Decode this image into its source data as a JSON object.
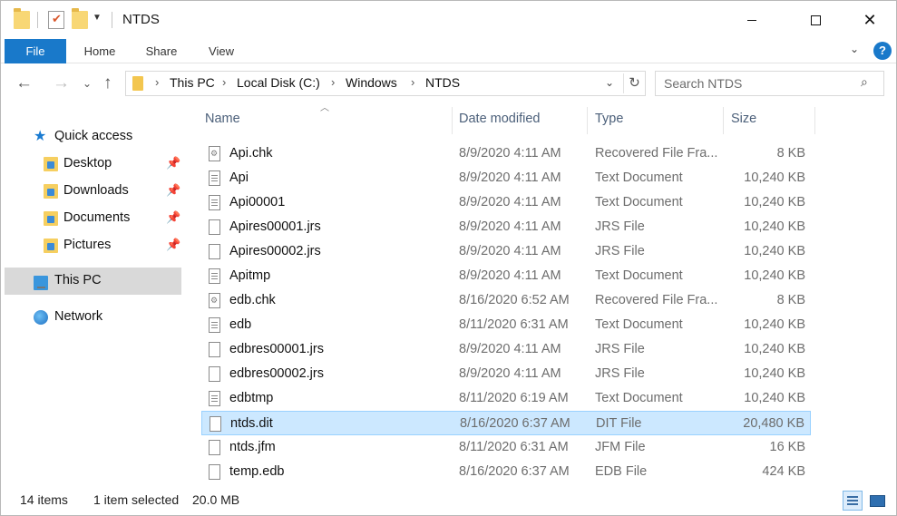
{
  "window": {
    "title": "NTDS"
  },
  "ribbon": {
    "tabs": [
      "File",
      "Home",
      "Share",
      "View"
    ],
    "help_label": "?"
  },
  "address": {
    "crumbs": [
      "This PC",
      "Local Disk (C:)",
      "Windows",
      "NTDS"
    ]
  },
  "search": {
    "placeholder": "Search NTDS"
  },
  "nav": {
    "quick_access": "Quick access",
    "pinned": [
      {
        "label": "Desktop"
      },
      {
        "label": "Downloads"
      },
      {
        "label": "Documents"
      },
      {
        "label": "Pictures"
      }
    ],
    "this_pc": "This PC",
    "network": "Network"
  },
  "columns": {
    "name": "Name",
    "date": "Date modified",
    "type": "Type",
    "size": "Size"
  },
  "files": [
    {
      "name": "Api.chk",
      "date": "8/9/2020 4:11 AM",
      "type": "Recovered File Fra...",
      "size": "8 KB",
      "icon": "chk",
      "selected": false
    },
    {
      "name": "Api",
      "date": "8/9/2020 4:11 AM",
      "type": "Text Document",
      "size": "10,240 KB",
      "icon": "txt",
      "selected": false
    },
    {
      "name": "Api00001",
      "date": "8/9/2020 4:11 AM",
      "type": "Text Document",
      "size": "10,240 KB",
      "icon": "txt",
      "selected": false
    },
    {
      "name": "Apires00001.jrs",
      "date": "8/9/2020 4:11 AM",
      "type": "JRS File",
      "size": "10,240 KB",
      "icon": "blank",
      "selected": false
    },
    {
      "name": "Apires00002.jrs",
      "date": "8/9/2020 4:11 AM",
      "type": "JRS File",
      "size": "10,240 KB",
      "icon": "blank",
      "selected": false
    },
    {
      "name": "Apitmp",
      "date": "8/9/2020 4:11 AM",
      "type": "Text Document",
      "size": "10,240 KB",
      "icon": "txt",
      "selected": false
    },
    {
      "name": "edb.chk",
      "date": "8/16/2020 6:52 AM",
      "type": "Recovered File Fra...",
      "size": "8 KB",
      "icon": "chk",
      "selected": false
    },
    {
      "name": "edb",
      "date": "8/11/2020 6:31 AM",
      "type": "Text Document",
      "size": "10,240 KB",
      "icon": "txt",
      "selected": false
    },
    {
      "name": "edbres00001.jrs",
      "date": "8/9/2020 4:11 AM",
      "type": "JRS File",
      "size": "10,240 KB",
      "icon": "blank",
      "selected": false
    },
    {
      "name": "edbres00002.jrs",
      "date": "8/9/2020 4:11 AM",
      "type": "JRS File",
      "size": "10,240 KB",
      "icon": "blank",
      "selected": false
    },
    {
      "name": "edbtmp",
      "date": "8/11/2020 6:19 AM",
      "type": "Text Document",
      "size": "10,240 KB",
      "icon": "txt",
      "selected": false
    },
    {
      "name": "ntds.dit",
      "date": "8/16/2020 6:37 AM",
      "type": "DIT File",
      "size": "20,480 KB",
      "icon": "blank",
      "selected": true
    },
    {
      "name": "ntds.jfm",
      "date": "8/11/2020 6:31 AM",
      "type": "JFM File",
      "size": "16 KB",
      "icon": "blank",
      "selected": false
    },
    {
      "name": "temp.edb",
      "date": "8/16/2020 6:37 AM",
      "type": "EDB File",
      "size": "424 KB",
      "icon": "blank",
      "selected": false
    }
  ],
  "status": {
    "items_count": "14 items",
    "selection": "1 item selected",
    "selection_size": "20.0 MB"
  },
  "colors": {
    "accent": "#1979ca",
    "selection_bg": "#cce8ff",
    "selection_border": "#99d1ff",
    "header_text": "#4c607a"
  }
}
